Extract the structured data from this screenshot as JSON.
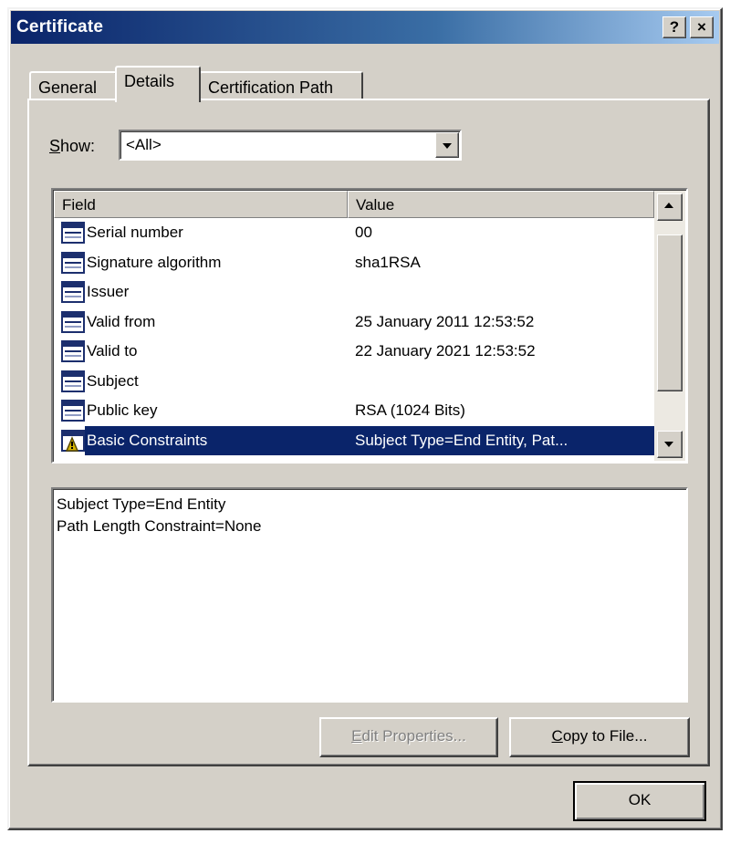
{
  "window": {
    "title": "Certificate",
    "help_label": "?",
    "close_label": "×"
  },
  "tabs": [
    {
      "label": "General",
      "active": false
    },
    {
      "label": "Details",
      "active": true
    },
    {
      "label": "Certification Path",
      "active": false
    }
  ],
  "show": {
    "label_prefix": "",
    "label_hotkey": "S",
    "label_rest": "how:",
    "value": "<All>"
  },
  "list": {
    "columns": [
      "Field",
      "Value"
    ],
    "rows": [
      {
        "field": "Serial number",
        "value": "00",
        "icon": "certificate-field-icon"
      },
      {
        "field": "Signature algorithm",
        "value": "sha1RSA",
        "icon": "certificate-field-icon"
      },
      {
        "field": "Issuer",
        "value": "",
        "icon": "certificate-field-icon"
      },
      {
        "field": "Valid from",
        "value": "25 January 2011 12:53:52",
        "icon": "certificate-field-icon"
      },
      {
        "field": "Valid to",
        "value": "22 January 2021 12:53:52",
        "icon": "certificate-field-icon"
      },
      {
        "field": "Subject",
        "value": "",
        "icon": "certificate-field-icon"
      },
      {
        "field": "Public key",
        "value": "RSA (1024 Bits)",
        "icon": "certificate-field-icon"
      },
      {
        "field": "Basic Constraints",
        "value": "Subject Type=End Entity, Pat...",
        "icon": "extension-field-icon",
        "selected": true
      }
    ]
  },
  "details_text": {
    "line1": "Subject Type=End Entity",
    "line2": "Path Length Constraint=None"
  },
  "buttons": {
    "edit_hotkey": "E",
    "edit_rest": "dit Properties...",
    "copy_hotkey": "C",
    "copy_rest": "opy to File...",
    "ok": "OK"
  },
  "colors": {
    "title_bar": "#0a246a",
    "selection": "#0a246a",
    "face": "#d4d0c8"
  }
}
